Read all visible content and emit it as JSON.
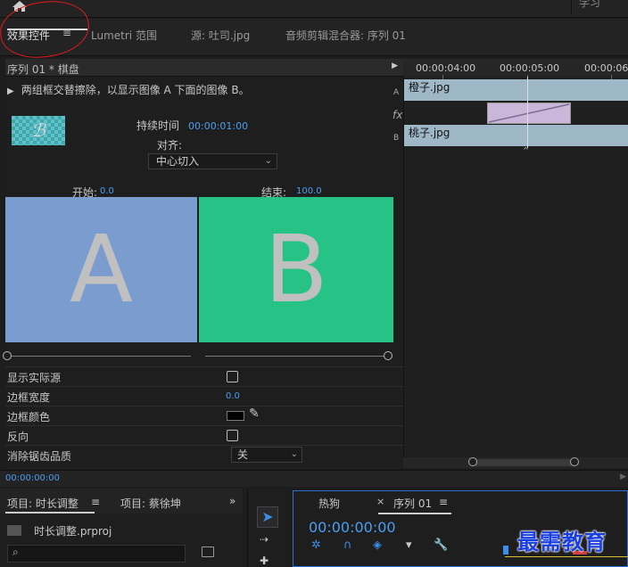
{
  "top_bar": {
    "learn_tab": "学习"
  },
  "panel_tabs": {
    "effect_controls": "效果控件",
    "menu_glyph": "≡",
    "lumetri": "Lumetri 范围",
    "source": "源: 吐司.jpg",
    "audio_mixer": "音频剪辑混合器: 序列 01"
  },
  "effect_controls": {
    "sequence_title": "序列 01 * 棋盘",
    "description": "两组框交替擦除，以显示图像 A 下面的图像 B。",
    "track_a": "A",
    "track_b": "B",
    "fx_label": "fx",
    "duration_label": "持续时间",
    "duration_value": "00:00:01:00",
    "align_label": "对齐:",
    "align_value": "中心切入",
    "start_label": "开始:",
    "start_value": "0.0",
    "end_label": "结束:",
    "end_value": "100.0",
    "preview_a_letter": "A",
    "preview_b_letter": "B",
    "props": {
      "show_actual_sources": "显示实际源",
      "border_width": "边框宽度",
      "border_width_value": "0.0",
      "border_color": "边框颜色",
      "reverse": "反向",
      "anti_aliasing": "消除锯齿品质",
      "anti_aliasing_value": "关"
    },
    "timecode": "00:00:00:00"
  },
  "timeline": {
    "ticks": [
      "00:00:04:00",
      "00:00:05:00",
      "00:00:06"
    ],
    "clip_top": "橙子.jpg",
    "clip_bottom": "桃子.jpg"
  },
  "project": {
    "tab1": "项目: 时长调整",
    "tab1_menu": "≡",
    "tab2": "项目: 蔡徐坤",
    "more": "»",
    "file": "时长调整.prproj"
  },
  "sequence": {
    "tab_dog": "热狗",
    "close": "×",
    "tab_seq": "序列 01",
    "menu": "≡",
    "timecode": "00:00:00:00"
  },
  "watermark": "最需教育",
  "colors": {
    "accent_blue": "#4a9ef0",
    "preview_a": "#7a9ccf",
    "preview_b": "#26c286",
    "clip": "#9fb8c8",
    "transition": "#c9b6d8",
    "annotation_red": "#e01b1b"
  }
}
